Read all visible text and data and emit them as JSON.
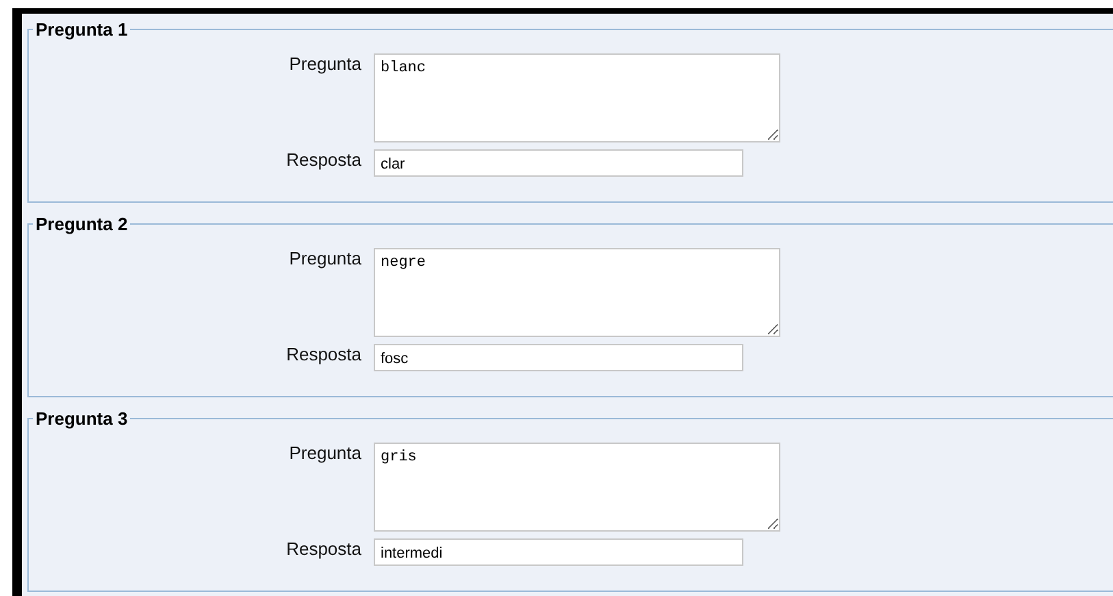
{
  "questions": [
    {
      "legend": "Pregunta 1",
      "question_label": "Pregunta",
      "question": "blanc",
      "answer_label": "Resposta",
      "answer": "clar"
    },
    {
      "legend": "Pregunta 2",
      "question_label": "Pregunta",
      "question": "negre",
      "answer_label": "Resposta",
      "answer": "fosc"
    },
    {
      "legend": "Pregunta 3",
      "question_label": "Pregunta",
      "question": "gris",
      "answer_label": "Resposta",
      "answer": "intermedi"
    }
  ]
}
